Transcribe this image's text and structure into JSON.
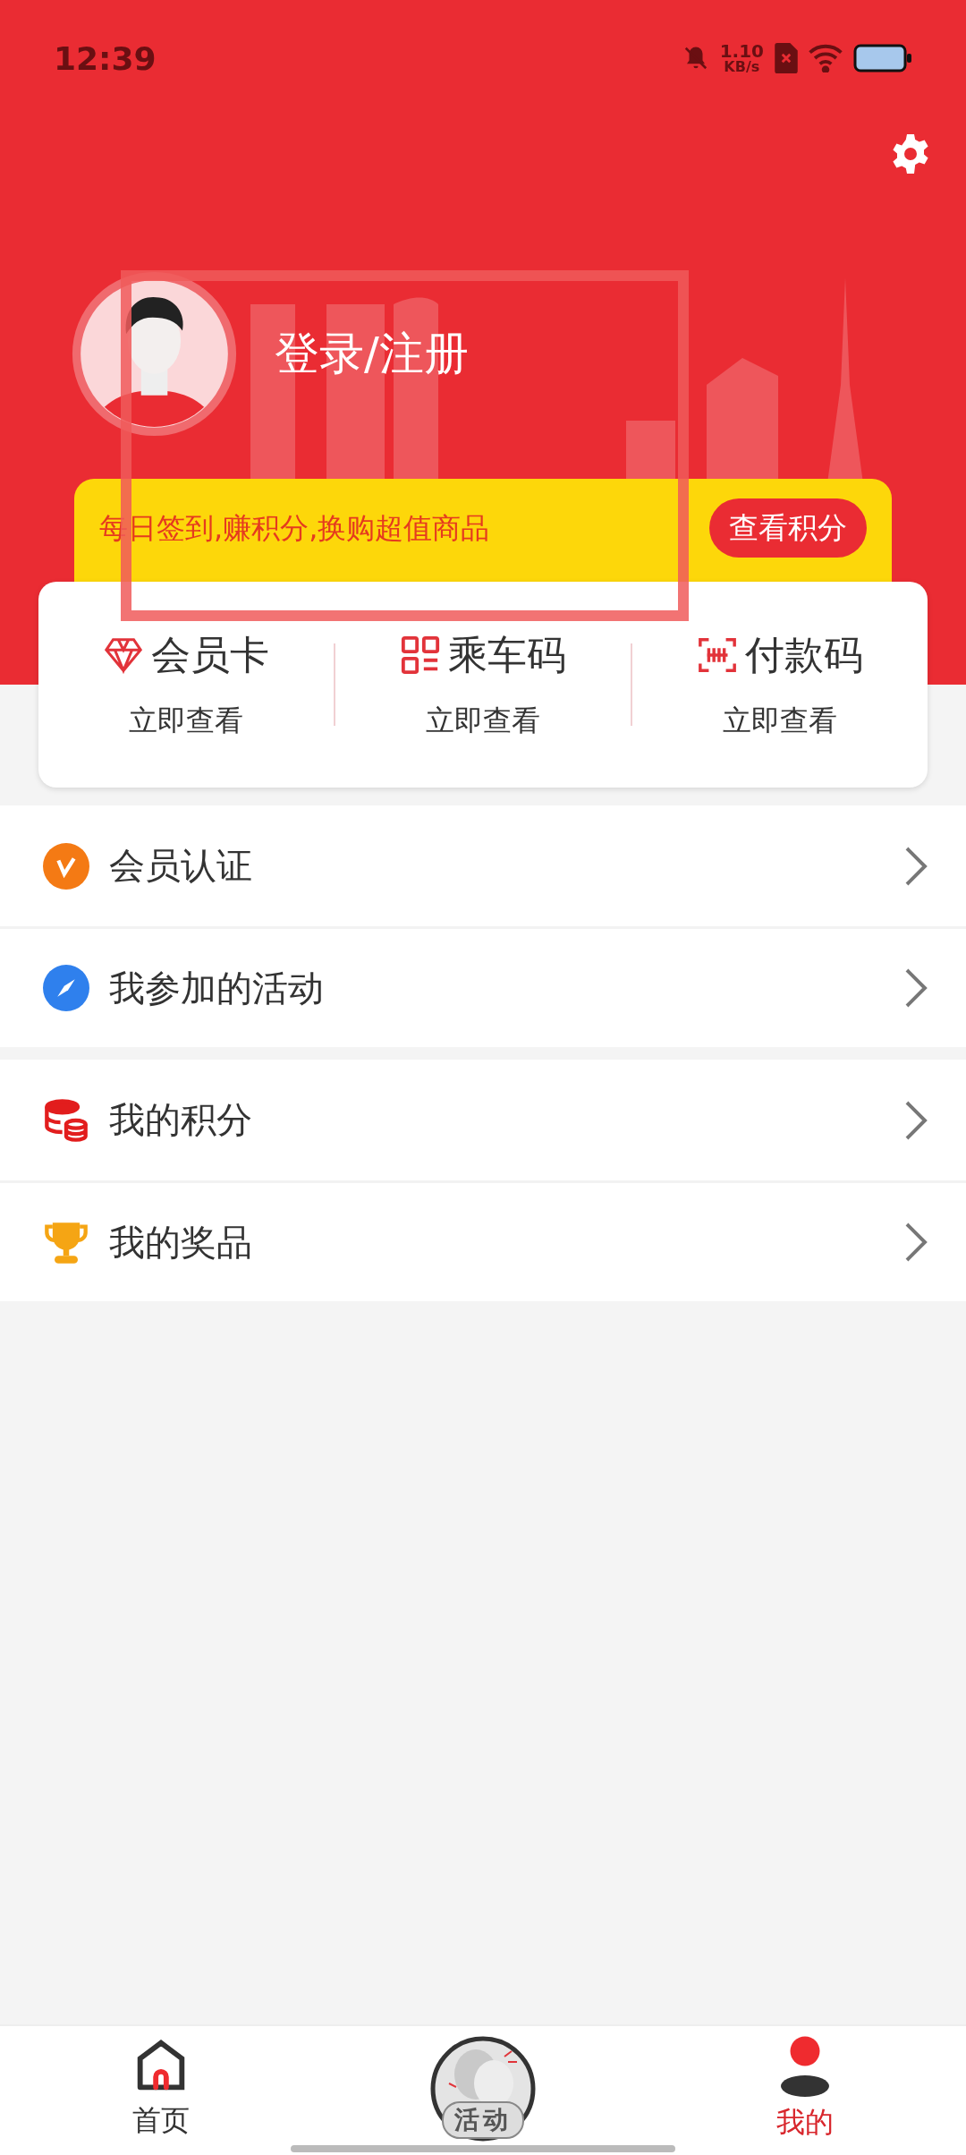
{
  "status_bar": {
    "time": "12:39",
    "speed_value": "1.10",
    "speed_unit": "KB/s"
  },
  "profile": {
    "login_label": "登录/注册"
  },
  "banner": {
    "text": "每日签到,赚积分,换购超值商品",
    "button": "查看积分"
  },
  "quick_cards": [
    {
      "kind": "diamond",
      "title": "会员卡",
      "action": "立即查看"
    },
    {
      "kind": "qr",
      "title": "乘车码",
      "action": "立即查看"
    },
    {
      "kind": "barcode",
      "title": "付款码",
      "action": "立即查看"
    }
  ],
  "menu_groups": [
    {
      "items": [
        {
          "kind": "verify",
          "label": "会员认证"
        },
        {
          "kind": "compass",
          "label": "我参加的活动"
        }
      ]
    },
    {
      "items": [
        {
          "kind": "coins",
          "label": "我的积分"
        },
        {
          "kind": "trophy",
          "label": "我的奖品"
        }
      ]
    }
  ],
  "bottom_nav": [
    {
      "kind": "home",
      "label": "首页",
      "selected": false
    },
    {
      "kind": "activity",
      "label": "活动",
      "selected": false
    },
    {
      "kind": "me",
      "label": "我的",
      "selected": true
    }
  ]
}
